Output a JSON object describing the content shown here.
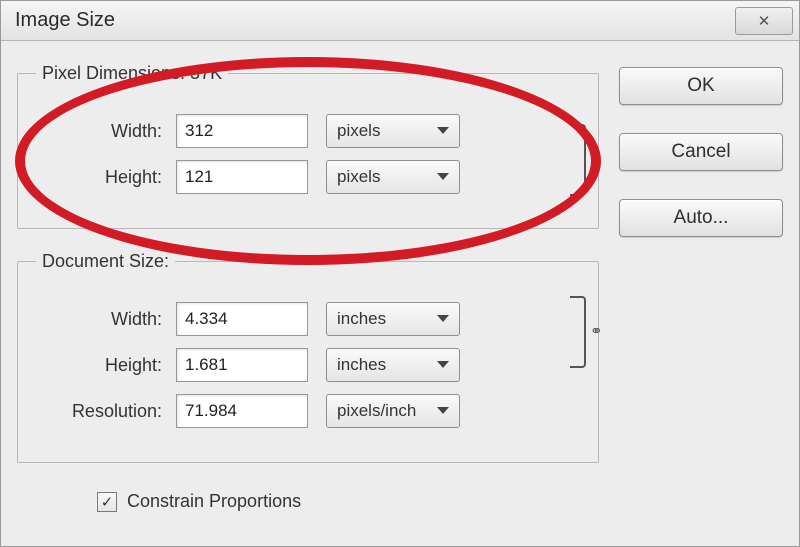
{
  "title": "Image Size",
  "close": "✕",
  "buttons": {
    "ok": "OK",
    "cancel": "Cancel",
    "auto": "Auto..."
  },
  "pixelDimensions": {
    "legend": "Pixel Dimensions:  37K",
    "widthLabel": "Width:",
    "widthValue": "312",
    "widthUnit": "pixels",
    "heightLabel": "Height:",
    "heightValue": "121",
    "heightUnit": "pixels"
  },
  "documentSize": {
    "legend": "Document Size:",
    "widthLabel": "Width:",
    "widthValue": "4.334",
    "widthUnit": "inches",
    "heightLabel": "Height:",
    "heightValue": "1.681",
    "heightUnit": "inches",
    "resolutionLabel": "Resolution:",
    "resolutionValue": "71.984",
    "resolutionUnit": "pixels/inch"
  },
  "constrain": {
    "label": "Constrain Proportions",
    "checked": true
  },
  "chainGlyph": "⚭",
  "checkmark": "✓"
}
